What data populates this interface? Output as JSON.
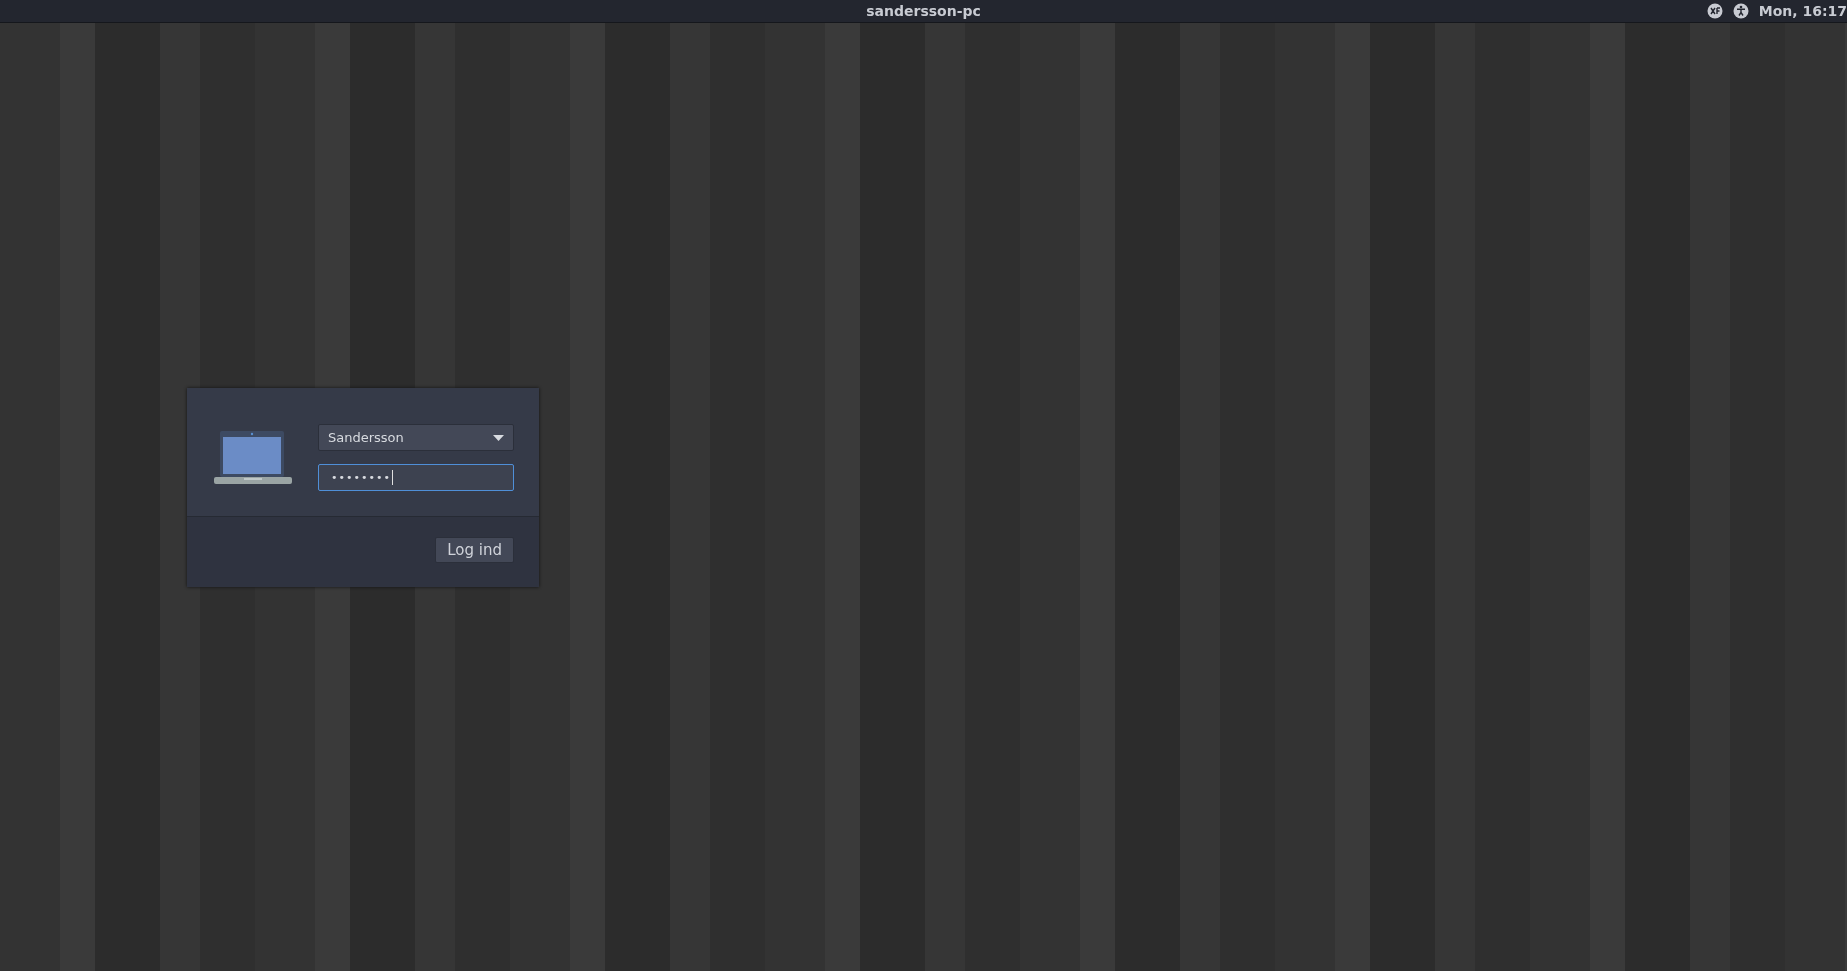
{
  "top_bar": {
    "hostname": "sandersson-pc",
    "clock": "Mon, 16:17"
  },
  "login": {
    "user": "Sandersson",
    "password": {
      "value": "••••••••",
      "focused": true
    },
    "button": "Log ind"
  }
}
